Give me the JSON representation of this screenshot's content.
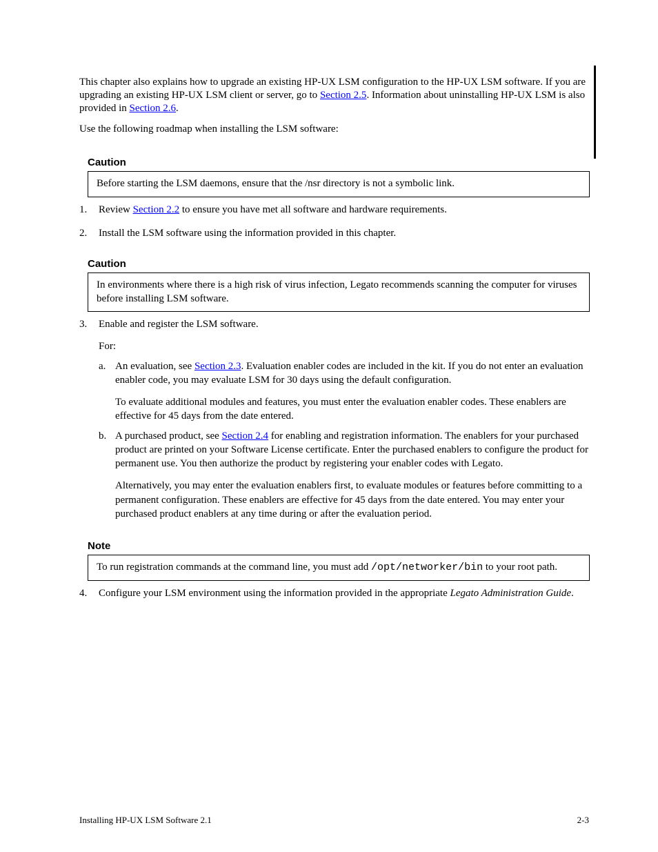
{
  "intro": {
    "p1_a": "This chapter also explains how to upgrade an existing HP-UX LSM configuration to the HP-UX LSM software. If you are upgrading an existing HP-UX LSM client or server, go to ",
    "p1_link": "Section 2.5",
    "p1_b": ". Information about uninstalling HP-UX LSM is also provided in ",
    "p1_link2": "Section 2.6",
    "p1_c": "."
  },
  "roadmap_line": "Use the following roadmap when installing the LSM software:",
  "notice1": {
    "label": "Caution",
    "body": "Before starting the LSM daemons, ensure that the /nsr directory is not a symbolic link."
  },
  "steps": {
    "s1_a": "Review ",
    "s1_link": "Section 2.2",
    "s1_b": " to ensure you have met all software and hardware requirements.",
    "s2": "Install the LSM software using the information provided in this chapter."
  },
  "notice2": {
    "label": "Caution",
    "body": "In environments where there is a high risk of virus infection, Legato recommends scanning the computer for viruses before installing LSM software."
  },
  "s3": {
    "num": "3.",
    "body": "Enable and register the LSM software.",
    "sub_for": "For:",
    "a_label": "a.",
    "a_body_pre": "An evaluation, see ",
    "a_link": "Section 2.3",
    "a_body_post": ". Evaluation enabler codes are included in the kit. If you do not enter an evaluation enabler code, you may evaluate LSM for 30 days using the default configuration.",
    "a_body_2": "To evaluate additional modules and features, you must enter the evaluation enabler codes. These enablers are effective for 45 days from the date entered.",
    "b_label": "b.",
    "b_body_pre": "A purchased product, see ",
    "b_link": "Section 2.4",
    "b_body_post": " for enabling and registration information. The enablers for your purchased product are printed on your Software License certificate. Enter the purchased enablers to configure the product for permanent use. You then authorize the product by registering your enabler codes with Legato.",
    "b_body_2": "Alternatively, you may enter the evaluation enablers first, to evaluate modules or features before committing to a permanent configuration. These enablers are effective for 45 days from the date entered. You may enter your purchased product enablers at any time during or after the evaluation period."
  },
  "notice3": {
    "label": "Note",
    "body_pre": "To run registration commands at the command line, you must add ",
    "body_code": "/opt/networker/bin",
    "body_post": " to your root path."
  },
  "s4": {
    "num": "4.",
    "body_pre": "Configure your LSM environment using the information provided in the appropriate ",
    "body_ital": "Legato Administration Guide",
    "body_post": "."
  },
  "footer": {
    "section": "Installing HP-UX LSM Software   2.1",
    "page": "2-3"
  }
}
